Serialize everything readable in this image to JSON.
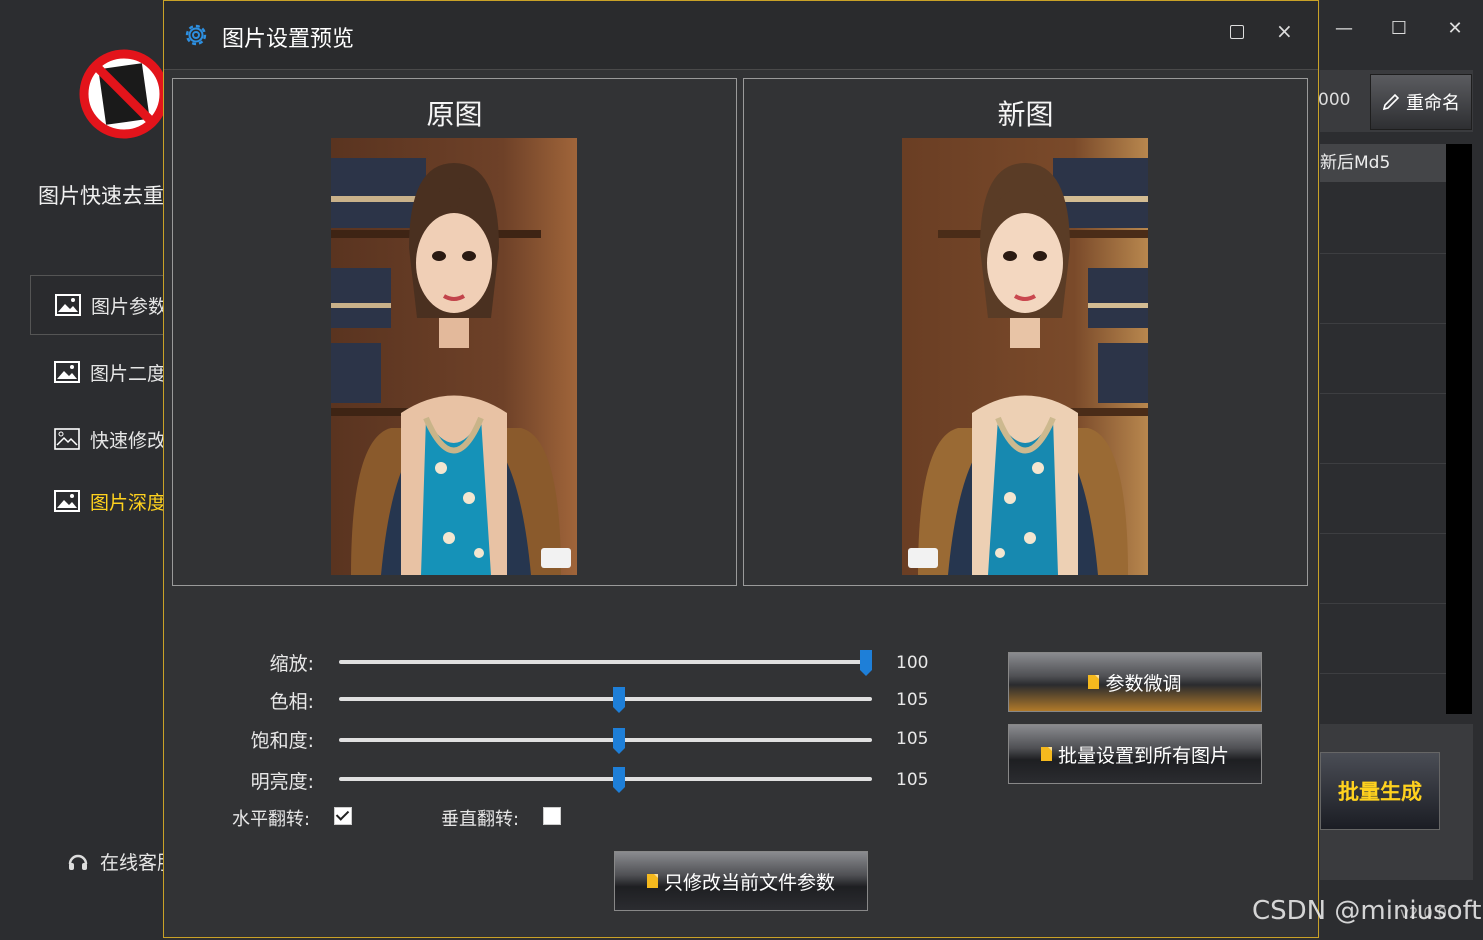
{
  "main_window": {
    "app_title": "图片快速去重",
    "nav": [
      {
        "label": "图片参数",
        "icon": "image-icon",
        "selected": true
      },
      {
        "label": "图片二度",
        "icon": "image-icon",
        "selected": false
      },
      {
        "label": "快速修改",
        "icon": "image-edit-icon",
        "selected": false
      },
      {
        "label": "图片深度",
        "icon": "image-icon",
        "selected": false,
        "color": "#ffd21e"
      }
    ],
    "service_label": "在线客服",
    "rename_label": "重命名",
    "number_fragment": "000",
    "md5_header": "新后Md5",
    "generate_label": "批量生成",
    "bottom_label": "v2.0.0",
    "window_controls": {
      "minimize": "—",
      "maximize": "☐",
      "close": "✕"
    }
  },
  "dialog": {
    "title": "图片设置预览",
    "maximize_icon": "maximize-icon",
    "close_label": "×",
    "original_title": "原图",
    "new_title": "新图",
    "sliders": [
      {
        "label": "缩放:",
        "value": "100",
        "fraction": 1.0
      },
      {
        "label": "色相:",
        "value": "105",
        "fraction": 0.525
      },
      {
        "label": "饱和度:",
        "value": "105",
        "fraction": 0.525
      },
      {
        "label": "明亮度:",
        "value": "105",
        "fraction": 0.525
      }
    ],
    "horizontal_flip": {
      "label": "水平翻转:",
      "checked": true
    },
    "vertical_flip": {
      "label": "垂直翻转:",
      "checked": false
    },
    "buttons": {
      "finetune": "参数微调",
      "batch_apply": "批量设置到所有图片",
      "only_current": "只修改当前文件参数"
    }
  },
  "watermark": "CSDN @miniusoft",
  "colors": {
    "accent_blue": "#1e7fd8",
    "highlight_yellow": "#ffd21e",
    "dialog_border": "#c9a227"
  }
}
